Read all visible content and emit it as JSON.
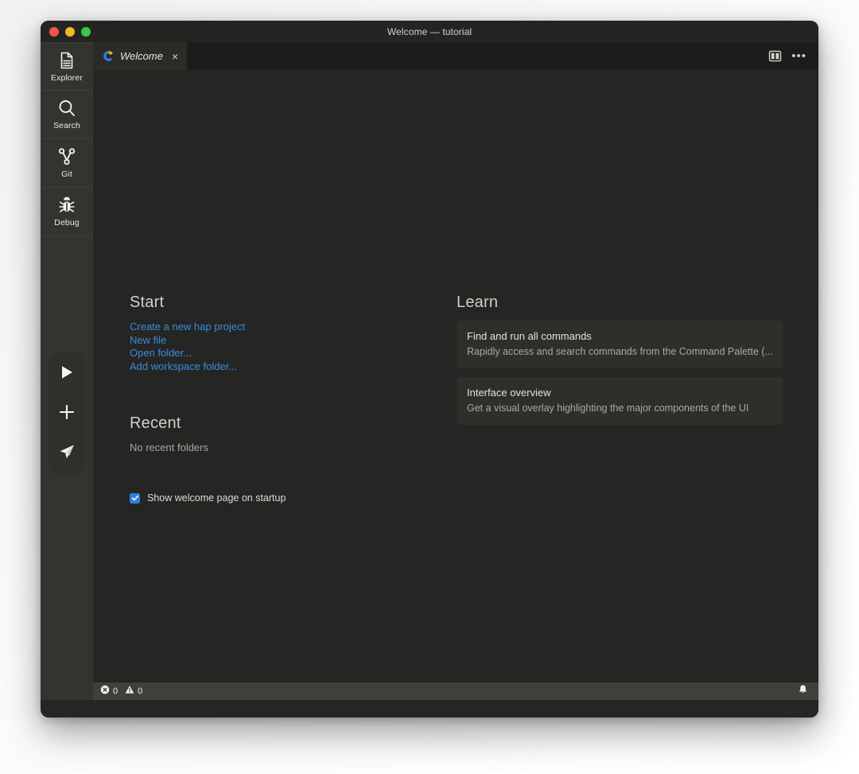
{
  "window": {
    "title": "Welcome — tutorial",
    "traffic_lights": [
      {
        "name": "close-button",
        "color": "#f1544a"
      },
      {
        "name": "minimize-button",
        "color": "#f5b82e"
      },
      {
        "name": "maximize-button",
        "color": "#3bc748"
      }
    ]
  },
  "activity_bar": {
    "items": [
      {
        "label": "Explorer",
        "icon": "file-document-icon"
      },
      {
        "label": "Search",
        "icon": "search-icon"
      },
      {
        "label": "Git",
        "icon": "git-branch-icon"
      },
      {
        "label": "Debug",
        "icon": "bug-icon"
      }
    ],
    "floating_actions": [
      {
        "name": "run-button",
        "icon": "play-icon"
      },
      {
        "name": "add-button",
        "icon": "plus-icon"
      },
      {
        "name": "send-button",
        "icon": "send-paper-plane-icon"
      }
    ]
  },
  "tabbar": {
    "tabs": [
      {
        "label": "Welcome",
        "icon": "app-logo-icon",
        "close": "×",
        "active": true
      }
    ],
    "actions": [
      {
        "name": "split-editor-button",
        "icon": "split-editor-icon"
      },
      {
        "name": "more-actions-button",
        "icon": "ellipsis-icon",
        "glyph": "•••"
      }
    ]
  },
  "welcome": {
    "start": {
      "heading": "Start",
      "links": [
        "Create a new hap project",
        "New file",
        "Open folder...",
        "Add workspace folder..."
      ]
    },
    "recent": {
      "heading": "Recent",
      "empty_text": "No recent folders"
    },
    "startup": {
      "label": "Show welcome page on startup",
      "checked": true
    },
    "learn": {
      "heading": "Learn",
      "cards": [
        {
          "title": "Find and run all commands",
          "description": "Rapidly access and search commands from the Command Palette (..."
        },
        {
          "title": "Interface overview",
          "description": "Get a visual overlay highlighting the major components of the UI"
        }
      ]
    }
  },
  "statusbar": {
    "errors": {
      "icon": "error-circle-icon",
      "count": "0"
    },
    "warnings": {
      "icon": "warning-triangle-icon",
      "count": "0"
    },
    "notifications": {
      "icon": "bell-icon"
    }
  },
  "colors": {
    "accent_link": "#3c8ade",
    "checkbox_blue": "#2f7fe0",
    "activity_bar_bg": "#333330",
    "editor_bg": "#252623",
    "tabbar_bg": "#1c1d1a",
    "active_tab_bg": "#2b2c28",
    "card_bg": "#2e2f2b",
    "statusbar_bg": "#3f4038"
  }
}
